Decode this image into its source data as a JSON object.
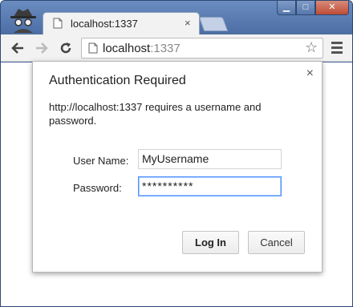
{
  "window": {
    "controls": {
      "minimize": "▁",
      "maximize": "□",
      "close": "✕"
    }
  },
  "tab": {
    "title": "localhost:1337",
    "close": "×"
  },
  "toolbar": {
    "url_host": "localhost",
    "url_port": ":1337"
  },
  "dialog": {
    "title": "Authentication Required",
    "close": "×",
    "message": "http://localhost:1337 requires a username and password.",
    "username_label": "User Name:",
    "username_value": "MyUsername",
    "password_label": "Password:",
    "password_value": "**********",
    "login_label": "Log In",
    "cancel_label": "Cancel"
  },
  "colors": {
    "titlebar": "#4d6fa6",
    "focus_border": "#4d90fe",
    "dialog_border": "#b8b8b8"
  },
  "icons": [
    "incognito-icon",
    "page-icon",
    "back-arrow-icon",
    "forward-arrow-icon",
    "reload-icon",
    "star-icon",
    "menu-icon",
    "close-icon"
  ]
}
